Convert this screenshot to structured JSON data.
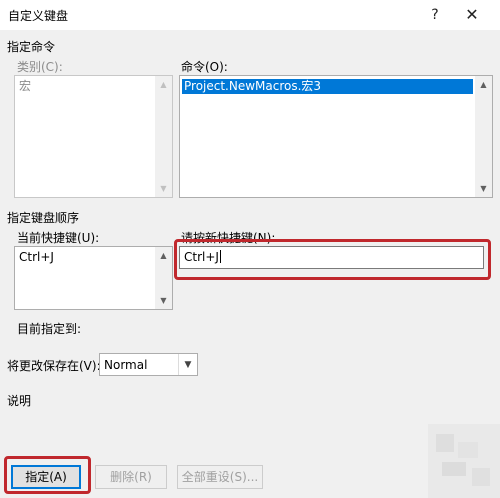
{
  "dialog": {
    "title": "自定义键盘"
  },
  "titlebar": {
    "help_glyph": "?",
    "close_glyph": "✕"
  },
  "command_section": {
    "heading": "指定命令",
    "categories_label": "类别(C):",
    "categories_items": [
      "宏"
    ],
    "commands_label": "命令(O):",
    "commands_items": [
      "Project.NewMacros.宏3"
    ]
  },
  "keyboard_section": {
    "heading": "指定键盘顺序",
    "current_keys_label": "当前快捷键(U):",
    "current_keys_items": [
      "Ctrl+J"
    ],
    "new_key_label": "请按新快捷键(N):",
    "new_key_value": "Ctrl+J",
    "assigned_to_label": "目前指定到:"
  },
  "save_in": {
    "label": "将更改保存在(V):",
    "value": "Normal"
  },
  "description": {
    "heading": "说明"
  },
  "buttons": {
    "assign": "指定(A)",
    "remove": "删除(R)",
    "reset_all": "全部重设(S)..."
  },
  "icons": {
    "scroll_up": "▲",
    "scroll_down": "▼",
    "dropdown": "▼"
  },
  "colors": {
    "highlight": "#c0282d",
    "selection": "#0078d7"
  }
}
